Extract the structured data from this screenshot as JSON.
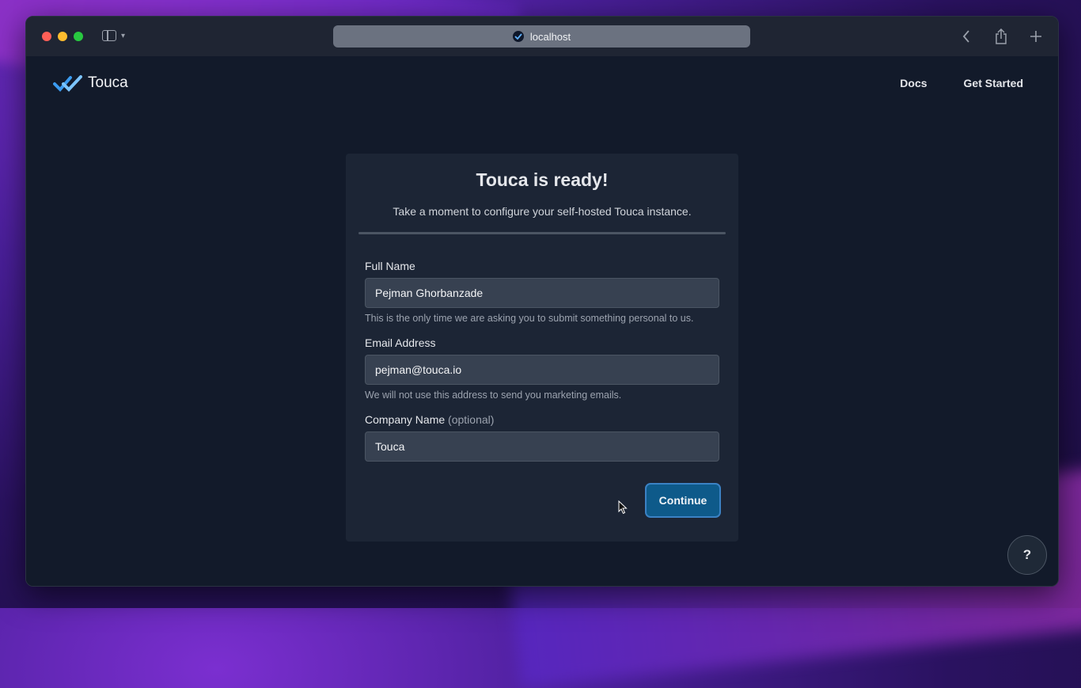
{
  "browser": {
    "url": "localhost"
  },
  "navbar": {
    "brand": "Touca",
    "links": [
      "Docs",
      "Get Started"
    ]
  },
  "card": {
    "title": "Touca is ready!",
    "subtitle": "Take a moment to configure your self-hosted Touca instance."
  },
  "form": {
    "full_name": {
      "label": "Full Name",
      "value": "Pejman Ghorbanzade",
      "help": "This is the only time we are asking you to submit something personal to us."
    },
    "email": {
      "label": "Email Address",
      "value": "pejman@touca.io",
      "help": "We will not use this address to send you marketing emails."
    },
    "company": {
      "label": "Company Name",
      "optional_note": "(optional)",
      "value": "Touca"
    },
    "submit_label": "Continue"
  },
  "help_button": "?",
  "colors": {
    "page_bg": "#121a2a",
    "card_bg": "#1c2535",
    "button_bg": "#0e5a8a",
    "brand_blue": "#3b9bf0"
  },
  "icons": [
    "sidebar-icon",
    "chevron-down-icon",
    "back-icon",
    "share-icon",
    "plus-icon",
    "touca-logo-icon"
  ]
}
